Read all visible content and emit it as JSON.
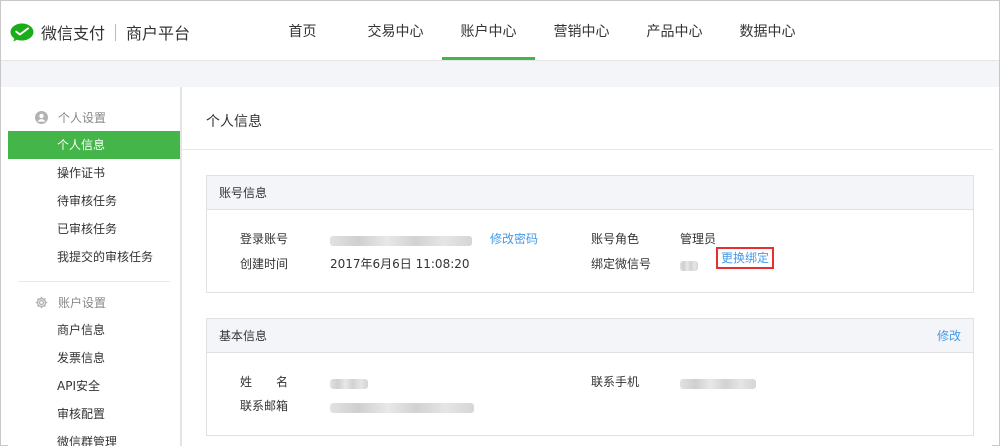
{
  "header": {
    "brand": "微信支付",
    "subtitle": "商户平台",
    "nav": [
      {
        "label": "首页"
      },
      {
        "label": "交易中心"
      },
      {
        "label": "账户中心",
        "active": true
      },
      {
        "label": "营销中心"
      },
      {
        "label": "产品中心"
      },
      {
        "label": "数据中心"
      }
    ]
  },
  "sidebar": {
    "groups": [
      {
        "title": "个人设置",
        "icon": "user-circle-icon",
        "items": [
          "个人信息",
          "操作证书",
          "待审核任务",
          "已审核任务",
          "我提交的审核任务"
        ],
        "active_index": 0
      },
      {
        "title": "账户设置",
        "icon": "gear-icon",
        "items": [
          "商户信息",
          "发票信息",
          "API安全",
          "审核配置",
          "微信群管理"
        ]
      }
    ]
  },
  "main": {
    "title": "个人信息",
    "account_panel": {
      "title": "账号信息",
      "login_label": "登录账号",
      "change_password": "修改密码",
      "created_label": "创建时间",
      "created_value": "2017年6月6日 11:08:20",
      "role_label": "账号角色",
      "role_value": "管理员",
      "wechat_label": "绑定微信号",
      "rebind": "更换绑定"
    },
    "basic_panel": {
      "title": "基本信息",
      "edit": "修改",
      "name_label": "姓　　名",
      "email_label": "联系邮箱",
      "phone_label": "联系手机"
    }
  },
  "colors": {
    "accent": "#44b549",
    "link": "#459ae9",
    "highlight": "#e63030",
    "panel_header_bg": "#f4f5f9"
  }
}
